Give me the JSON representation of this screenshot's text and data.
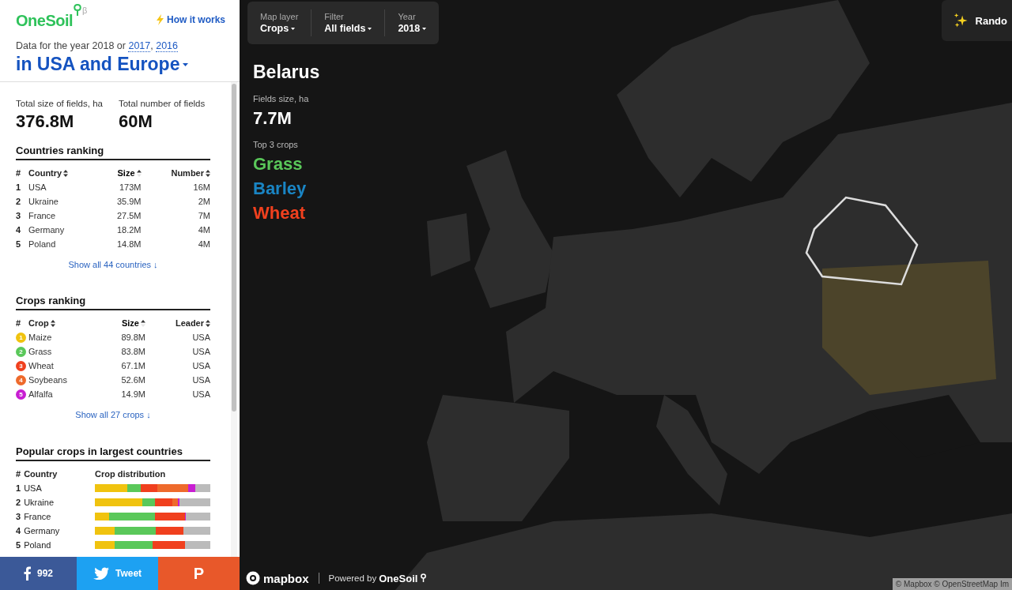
{
  "header": {
    "logo": "OneSoil",
    "logo_badge": "β",
    "how_link": "How it works",
    "year_line": [
      {
        "kind": "text",
        "text": "Data for the year 2018 or "
      },
      {
        "kind": "link",
        "text": "2017"
      },
      {
        "kind": "text",
        "text": ", "
      },
      {
        "kind": "link",
        "text": "2016"
      }
    ],
    "region": "in USA and Europe"
  },
  "totals": [
    {
      "label": "Total size of fields, ha",
      "value": "376.8M"
    },
    {
      "label": "Total number of fields",
      "value": "60M"
    }
  ],
  "countries_ranking": {
    "title": "Countries ranking",
    "columns": [
      {
        "label": "#",
        "sortable": false,
        "sorted": false
      },
      {
        "label": "Country",
        "sortable": true,
        "sorted": false
      },
      {
        "label": "Size",
        "sortable": true,
        "sorted": true
      },
      {
        "label": "Number",
        "sortable": true,
        "sorted": false
      }
    ],
    "rows": [
      [
        "1",
        "USA",
        "173M",
        "16M"
      ],
      [
        "2",
        "Ukraine",
        "35.9M",
        "2M"
      ],
      [
        "3",
        "France",
        "27.5M",
        "7M"
      ],
      [
        "4",
        "Germany",
        "18.2M",
        "4M"
      ],
      [
        "5",
        "Poland",
        "14.8M",
        "4M"
      ]
    ],
    "show_all": "Show all 44 countries ↓"
  },
  "crops_ranking": {
    "title": "Crops ranking",
    "columns": [
      {
        "label": "#",
        "sortable": false,
        "sorted": false
      },
      {
        "label": "Crop",
        "sortable": true,
        "sorted": false
      },
      {
        "label": "Size",
        "sortable": true,
        "sorted": true
      },
      {
        "label": "Leader",
        "sortable": true,
        "sorted": false
      }
    ],
    "rows": [
      {
        "rank": "1",
        "crop": "Maize",
        "size": "89.8M",
        "leader": "USA",
        "color": "#f0c30f"
      },
      {
        "rank": "2",
        "crop": "Grass",
        "size": "83.8M",
        "leader": "USA",
        "color": "#5ac85a"
      },
      {
        "rank": "3",
        "crop": "Wheat",
        "size": "67.1M",
        "leader": "USA",
        "color": "#f0401e"
      },
      {
        "rank": "4",
        "crop": "Soybeans",
        "size": "52.6M",
        "leader": "USA",
        "color": "#ee6a2c"
      },
      {
        "rank": "5",
        "crop": "Alfalfa",
        "size": "14.9M",
        "leader": "USA",
        "color": "#c81ed2"
      }
    ],
    "show_all": "Show all 27 crops ↓"
  },
  "popular": {
    "title": "Popular crops in largest countries",
    "columns": [
      "#",
      "Country",
      "Crop distribution"
    ],
    "rows": [
      {
        "rank": "1",
        "country": "USA",
        "segments": [
          {
            "color": "#f0c30f"
          },
          {
            "color": "#5ac85a"
          },
          {
            "color": "#f0401e"
          },
          {
            "color": "#ee6a2c"
          },
          {
            "color": "#c81ed2"
          },
          {
            "color": "#bbbbbb"
          }
        ]
      },
      {
        "rank": "2",
        "country": "Ukraine",
        "segments": [
          {
            "color": "#f0c30f"
          },
          {
            "color": "#5ac85a"
          },
          {
            "color": "#f0401e"
          },
          {
            "color": "#ee6a2c"
          },
          {
            "color": "#c81ed2"
          },
          {
            "color": "#bbbbbb"
          }
        ]
      },
      {
        "rank": "3",
        "country": "France",
        "segments": [
          {
            "color": "#f0c30f"
          },
          {
            "color": "#5ac85a"
          },
          {
            "color": "#f0401e"
          },
          {
            "color": "#c81ed2"
          },
          {
            "color": "#bbbbbb"
          }
        ]
      },
      {
        "rank": "4",
        "country": "Germany",
        "segments": [
          {
            "color": "#f0c30f"
          },
          {
            "color": "#5ac85a"
          },
          {
            "color": "#f0401e"
          },
          {
            "color": "#bbbbbb"
          }
        ]
      },
      {
        "rank": "5",
        "country": "Poland",
        "segments": [
          {
            "color": "#f0c30f"
          },
          {
            "color": "#5ac85a"
          },
          {
            "color": "#f0401e"
          },
          {
            "color": "#bbbbbb"
          }
        ]
      }
    ]
  },
  "share": [
    {
      "kind": "facebook",
      "label": "992"
    },
    {
      "kind": "twitter",
      "label": "Tweet"
    },
    {
      "kind": "pinterest",
      "label": "P"
    }
  ],
  "map": {
    "controls": [
      {
        "label": "Map layer",
        "value": "Crops"
      },
      {
        "label": "Filter",
        "value": "All fields"
      },
      {
        "label": "Year",
        "value": "2018"
      }
    ],
    "country": {
      "name": "Belarus",
      "size_label": "Fields size, ha",
      "size": "7.7M",
      "crops_label": "Top 3 crops",
      "crops": [
        {
          "name": "Grass",
          "color": "#5ac85a"
        },
        {
          "name": "Barley",
          "color": "#1a85c4"
        },
        {
          "name": "Wheat",
          "color": "#f0401e"
        }
      ]
    },
    "random": "Rando",
    "mapbox": "mapbox",
    "powered_by": "Powered by",
    "powered_brand": "OneSoil",
    "attribution": "© Mapbox © OpenStreetMap Im"
  }
}
